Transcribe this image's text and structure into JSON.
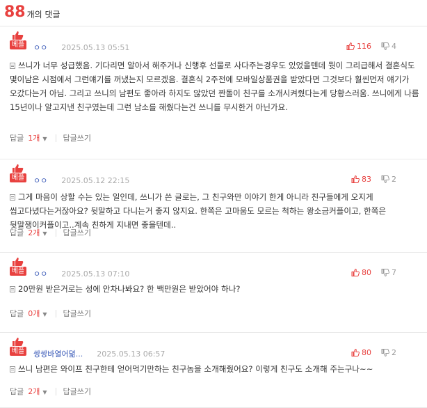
{
  "header": {
    "count": "88",
    "label": "개의 댓글"
  },
  "best_label": "베플",
  "reply_label": "답글",
  "write_reply_label": "답글쓰기",
  "comments": [
    {
      "user": "ㅇㅇ",
      "date": "2025.05.13 05:51",
      "up": "116",
      "down": "4",
      "text": "쓰니가 너무 성급했음. 기다리면 알아서 해주거나 신행후 선물로 사다주는경우도 있었을텐데 뭣이 그리급해서 결혼식도 몇이남은 시점에서 그런얘기를 꺼냈는지 모르겠음. 결혼식 2주전에 모바일상품권을 받았다면 그것보다 훨씬먼저 얘기가 오갔다는거 아님. 그리고 쓰니의 남편도 좋아라 하지도 않았던 짠돌이 친구를 소개시켜줬다는게 당황스러움. 쓰니에게 나름 15년이나 알고지낸 친구였는데 그런 남소를 해줬다는건 쓰니를 무시한거 아닌가요.",
      "reply_count": "1개"
    },
    {
      "user": "ㅇㅇ",
      "date": "2025.05.12 22:15",
      "up": "83",
      "down": "2",
      "text": "그게 마음이 상할 수는 있는 일인데, 쓰니가 쓴 글로는, 그 친구와만 이야기 한게 아니라 친구들에게 오지게 씹고다녔다는거잖아요? 뒷말하고 다니는거 좋지 않지요. 한쪽은 고마움도 모르는 척하는 왕소금커플이고, 한쪽은 뒷말쟁이커플이고..계속 친하게 지내면 좋을텐데..",
      "reply_count": "2개"
    },
    {
      "user": "ㅇㅇ",
      "date": "2025.05.13 07:10",
      "up": "80",
      "down": "7",
      "text": "20만원 받은거로는 성에 안차나봐요? 한 백만원은 받았어야 하나?",
      "reply_count": "0개"
    },
    {
      "user": "쌍쌍바열어뎖...",
      "date": "2025.05.13 06:57",
      "up": "80",
      "down": "2",
      "text": "쓰니 남편은 와이프 친구한테 얻어먹기만하는 친구놈을 소개해줬어요? 이렇게 친구도 소개해 주는구나~~",
      "reply_count": "2개"
    }
  ]
}
